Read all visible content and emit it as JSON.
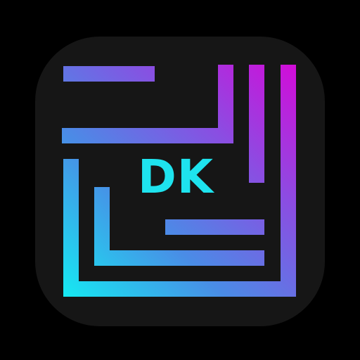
{
  "app_icon": {
    "monogram": "DK",
    "icon_name": "dk-maze-logo-icon",
    "colors": {
      "background": "#000000",
      "tile": "#161616",
      "monogram": "#1ee3ee",
      "gradient_cyan": "#15eaf2",
      "gradient_blue": "#4a8ce6",
      "gradient_purple": "#8a4ee2",
      "gradient_magenta": "#d40ad8"
    }
  }
}
